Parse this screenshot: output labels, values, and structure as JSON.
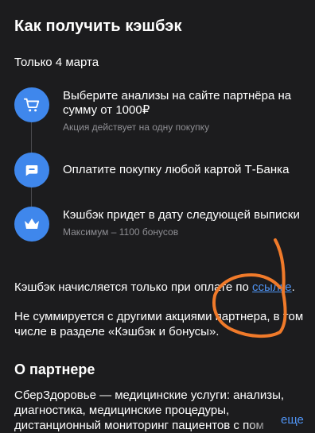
{
  "header": {
    "title": "Как получить кэшбэк",
    "date": "Только 4 марта"
  },
  "steps": [
    {
      "icon": "shopping-cart-icon",
      "title": "Выберите анализы на сайте партнёра на сумму от 1000₽",
      "subtitle": "Акция действует на одну покупку"
    },
    {
      "icon": "card-icon",
      "title": "Оплатите покупку любой картой Т‑Банка",
      "subtitle": ""
    },
    {
      "icon": "crown-icon",
      "title": "Кэшбэк придет в дату следующей выписки",
      "subtitle": "Максимум – 1100 бонусов"
    }
  ],
  "info": {
    "paid_text": "Кэшбэк начисляется только при оплате по ",
    "link_label": "ссылке",
    "paid_end": ".",
    "not_combined": "Не суммируется с другими акциями партнера, в том числе в разделе «Кэшбэк и бонусы»."
  },
  "partner": {
    "heading": "О партнере",
    "description": "СберЗдоровье — медицинские услуги: анализы, диагностика, медицинские процедуры, дистанционный мониторинг пациентов с пом",
    "more_label": "еще"
  },
  "colors": {
    "background": "#1c1c1e",
    "accent": "#3f87ec",
    "link": "#4f93f2",
    "secondary_text": "#8e8e93",
    "annotation": "#f07a2a"
  }
}
